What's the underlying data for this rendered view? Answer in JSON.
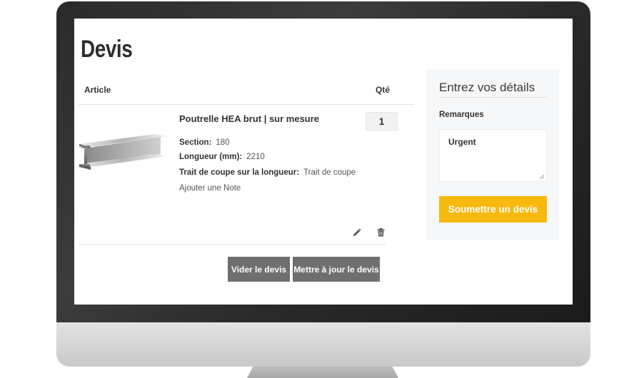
{
  "page": {
    "title": "Devis"
  },
  "table": {
    "col_article": "Article",
    "col_qty": "Qté"
  },
  "item": {
    "name": "Poutrelle HEA brut | sur mesure",
    "attributes": [
      {
        "label": "Section:",
        "value": "180"
      },
      {
        "label": "Longueur (mm):",
        "value": "2210"
      },
      {
        "label": "Trait de coupe sur la longueur:",
        "value": "Trait de coupe"
      }
    ],
    "add_note": "Ajouter une Note",
    "qty": "1",
    "edit_icon": "pencil-icon",
    "delete_icon": "trash-icon"
  },
  "actions": {
    "clear": "Vider le devis",
    "update": "Mettre à jour le devis"
  },
  "panel": {
    "title": "Entrez vos détails",
    "remarks_label": "Remarques",
    "remarks_value": "Urgent",
    "submit": "Soumettre un devis"
  },
  "colors": {
    "accent": "#f8b90e",
    "dark_button": "#6f6f6f",
    "panel_bg": "#f6f7f9"
  }
}
